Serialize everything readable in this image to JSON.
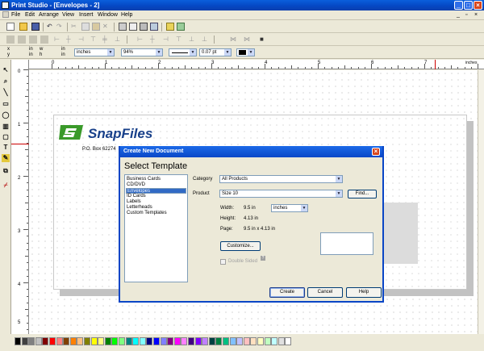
{
  "window": {
    "title": "Print Studio - [Envelopes - 2]"
  },
  "menu": [
    "File",
    "Edit",
    "Arrange",
    "View",
    "Insert",
    "Window",
    "Help"
  ],
  "format_bar": {
    "x_label": "x",
    "y_label": "y",
    "in1": "in",
    "in2": "in",
    "w_label": "w",
    "h_label": "h",
    "in3": "in",
    "in4": "in",
    "units": "inches",
    "zoom": "94%",
    "line_width": "0.07 pt"
  },
  "ruler": {
    "h_ticks": [
      "0",
      "1",
      "2",
      "3",
      "4",
      "5",
      "6",
      "7",
      "8"
    ],
    "h_unit": "inches",
    "v_ticks": [
      "0",
      "1",
      "2",
      "3",
      "4",
      "5"
    ]
  },
  "document": {
    "logo_text": "SnapFiles",
    "address": "P.O. Box 62274"
  },
  "dialog": {
    "title": "Create New Document",
    "section": "Select Template",
    "templates": [
      "Business Cards",
      "CD/DVD",
      "Envelopes",
      "ID Cards",
      "Labels",
      "Letterheads",
      "Custom Templates"
    ],
    "selected_template": "Envelopes",
    "category_label": "Category",
    "category_value": "All Products",
    "product_label": "Product",
    "product_value": "Size 10",
    "find_button": "Find...",
    "width_label": "Width:",
    "width_value": "9.5 in",
    "width_units": "inches",
    "height_label": "Height:",
    "height_value": "4.13 in",
    "page_label": "Page:",
    "page_value": "9.5 in x 4.13 in",
    "customize_button": "Customize...",
    "double_sided_label": "Double Sided",
    "create_button": "Create",
    "cancel_button": "Cancel",
    "help_button": "Help"
  },
  "palette_colors": [
    "#000000",
    "#404040",
    "#808080",
    "#c0c0c0",
    "#800000",
    "#ff0000",
    "#ff8080",
    "#804000",
    "#ff8000",
    "#ffc080",
    "#808000",
    "#ffff00",
    "#ffff80",
    "#008000",
    "#00ff00",
    "#80ff80",
    "#008080",
    "#00ffff",
    "#80ffff",
    "#000080",
    "#0000ff",
    "#8080ff",
    "#800080",
    "#ff00ff",
    "#ff80ff",
    "#400080",
    "#8000ff",
    "#c080ff",
    "#004040",
    "#008040",
    "#00c080",
    "#80c0ff",
    "#c0c0ff",
    "#ffc0c0",
    "#ffe0c0",
    "#ffffc0",
    "#c0ffc0",
    "#c0ffff",
    "#e0e0e0",
    "#ffffff"
  ]
}
